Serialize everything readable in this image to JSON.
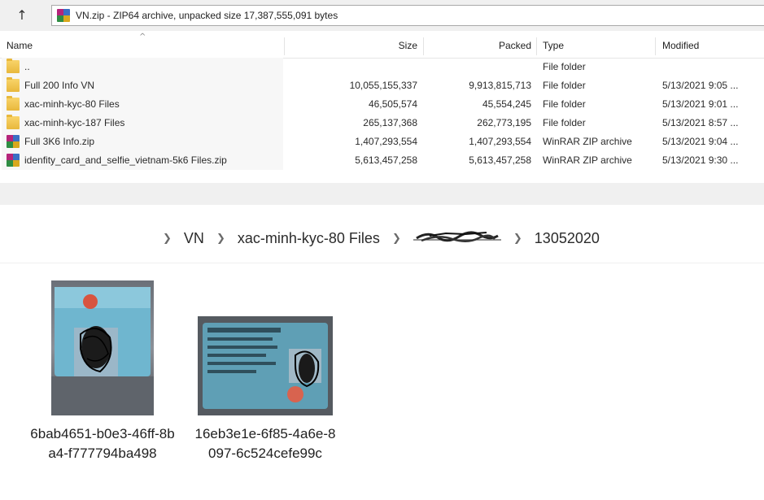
{
  "winrar": {
    "path_text": "VN.zip - ZIP64 archive, unpacked size 17,387,555,091 bytes",
    "columns": {
      "name": "Name",
      "size": "Size",
      "packed": "Packed",
      "type": "Type",
      "modified": "Modified"
    },
    "rows": [
      {
        "name": "..",
        "size": "",
        "packed": "",
        "type": "File folder",
        "modified": "",
        "icon": "folder-icon"
      },
      {
        "name": "Full 200 Info VN",
        "size": "10,055,155,337",
        "packed": "9,913,815,713",
        "type": "File folder",
        "modified": "5/13/2021 9:05 ...",
        "icon": "folder-icon"
      },
      {
        "name": "xac-minh-kyc-80 Files",
        "size": "46,505,574",
        "packed": "45,554,245",
        "type": "File folder",
        "modified": "5/13/2021 9:01 ...",
        "icon": "folder-icon"
      },
      {
        "name": "xac-minh-kyc-187 Files",
        "size": "265,137,368",
        "packed": "262,773,195",
        "type": "File folder",
        "modified": "5/13/2021 8:57 ...",
        "icon": "folder-icon"
      },
      {
        "name": "Full 3K6 Info.zip",
        "size": "1,407,293,554",
        "packed": "1,407,293,554",
        "type": "WinRAR ZIP archive",
        "modified": "5/13/2021 9:04 ...",
        "icon": "winrar-zip-icon"
      },
      {
        "name": "idenfity_card_and_selfie_vietnam-5k6 Files.zip",
        "size": "5,613,457,258",
        "packed": "5,613,457,258",
        "type": "WinRAR ZIP archive",
        "modified": "5/13/2021 9:30 ...",
        "icon": "winrar-zip-icon"
      }
    ]
  },
  "explorer": {
    "breadcrumb": [
      "VN",
      "xac-minh-kyc-80 Files",
      "13052020"
    ],
    "files": [
      {
        "name": "6bab4651-b0e3-46ff-8ba4-f777794ba498"
      },
      {
        "name": "16eb3e1e-6f85-4a6e-8097-6c524cefe99c"
      }
    ]
  },
  "colors": {
    "toolbar_bg": "#f0f0f0",
    "folder_yellow": "#f3c94f",
    "row_highlight": "#f7f7f7"
  }
}
